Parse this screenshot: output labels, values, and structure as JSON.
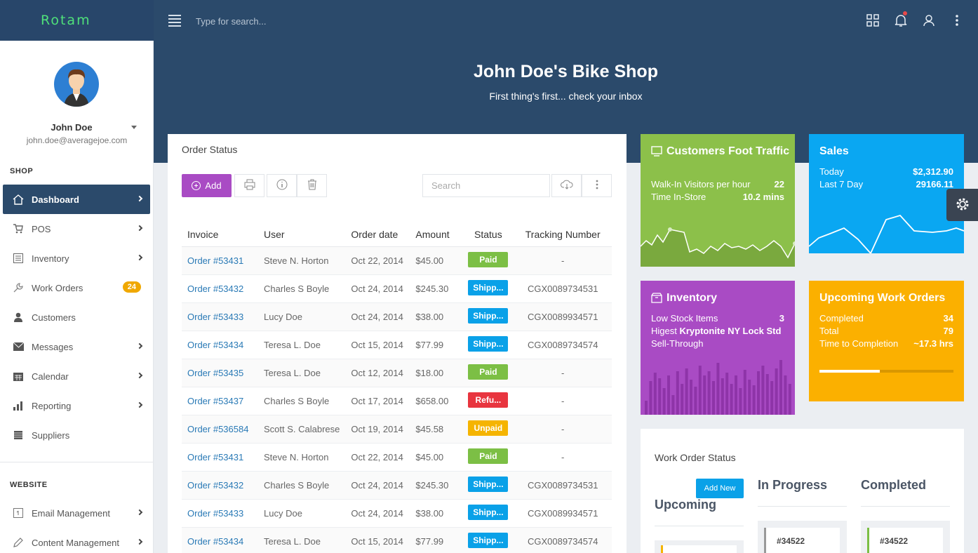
{
  "brand": "Rotam",
  "topbar": {
    "search_placeholder": "Type for search...",
    "icons": [
      "menu-icon",
      "grid-icon",
      "bell-icon",
      "user-icon",
      "more-vertical-icon"
    ]
  },
  "hero": {
    "title": "John Doe's Bike Shop",
    "subtitle": "First thing's first... check your inbox"
  },
  "user": {
    "name": "John Doe",
    "email": "john.doe@averagejoe.com"
  },
  "sidebar": {
    "shop_label": "SHOP",
    "items": [
      {
        "label": "Dashboard",
        "icon": "home-icon"
      },
      {
        "label": "POS",
        "icon": "cart-icon"
      },
      {
        "label": "Inventory",
        "icon": "list-icon"
      },
      {
        "label": "Work Orders",
        "icon": "wrench-icon",
        "badge": "24"
      },
      {
        "label": "Customers",
        "icon": "person-icon"
      },
      {
        "label": "Messages",
        "icon": "envelope-icon"
      },
      {
        "label": "Calendar",
        "icon": "calendar-icon"
      },
      {
        "label": "Reporting",
        "icon": "bar-chart-icon"
      },
      {
        "label": "Suppliers",
        "icon": "truck-icon"
      }
    ],
    "website_label": "WEBSITE",
    "website_items": [
      {
        "label": "Email Management",
        "icon": "email-icon"
      },
      {
        "label": "Content Management",
        "icon": "pencil-icon"
      }
    ]
  },
  "order_status": {
    "title": "Order Status",
    "add_label": "Add",
    "search_placeholder": "Search",
    "columns": [
      "Invoice",
      "User",
      "Order date",
      "Amount",
      "Status",
      "Tracking Number"
    ],
    "rows": [
      {
        "invoice": "Order #53431",
        "user": "Steve N. Horton",
        "date": "Oct 22, 2014",
        "amount": "$45.00",
        "status": "Paid",
        "tracking": "-"
      },
      {
        "invoice": "Order #53432",
        "user": "Charles S Boyle",
        "date": "Oct 24, 2014",
        "amount": "$245.30",
        "status": "Shipp...",
        "tracking": "CGX0089734531"
      },
      {
        "invoice": "Order #53433",
        "user": "Lucy Doe",
        "date": "Oct 24, 2014",
        "amount": "$38.00",
        "status": "Shipp...",
        "tracking": "CGX0089934571"
      },
      {
        "invoice": "Order #53434",
        "user": "Teresa L. Doe",
        "date": "Oct 15, 2014",
        "amount": "$77.99",
        "status": "Shipp...",
        "tracking": "CGX0089734574"
      },
      {
        "invoice": "Order #53435",
        "user": "Teresa L. Doe",
        "date": "Oct 12, 2014",
        "amount": "$18.00",
        "status": "Paid",
        "tracking": "-"
      },
      {
        "invoice": "Order #53437",
        "user": "Charles S Boyle",
        "date": "Oct 17, 2014",
        "amount": "$658.00",
        "status": "Refu...",
        "tracking": "-"
      },
      {
        "invoice": "Order #536584",
        "user": "Scott S. Calabrese",
        "date": "Oct 19, 2014",
        "amount": "$45.58",
        "status": "Unpaid",
        "tracking": "-"
      },
      {
        "invoice": "Order #53431",
        "user": "Steve N. Horton",
        "date": "Oct 22, 2014",
        "amount": "$45.00",
        "status": "Paid",
        "tracking": "-"
      },
      {
        "invoice": "Order #53432",
        "user": "Charles S Boyle",
        "date": "Oct 24, 2014",
        "amount": "$245.30",
        "status": "Shipp...",
        "tracking": "CGX0089734531"
      },
      {
        "invoice": "Order #53433",
        "user": "Lucy Doe",
        "date": "Oct 24, 2014",
        "amount": "$38.00",
        "status": "Shipp...",
        "tracking": "CGX0089934571"
      },
      {
        "invoice": "Order #53434",
        "user": "Teresa L. Doe",
        "date": "Oct 15, 2014",
        "amount": "$77.99",
        "status": "Shipp...",
        "tracking": "CGX0089734574"
      }
    ],
    "status_colors": {
      "Paid": "#7cbf45",
      "Shipp...": "#0aa1e8",
      "Refu...": "#e8353f",
      "Unpaid": "#f5b400"
    }
  },
  "widgets": {
    "traffic": {
      "title": "Customers Foot Traffic",
      "rows": [
        {
          "label": "Walk-In Visitors per hour",
          "value": "22"
        },
        {
          "label": "Time In-Store",
          "value": "10.2 mins"
        }
      ],
      "color": "#8cc04a"
    },
    "sales": {
      "title": "Sales",
      "rows": [
        {
          "label": "Today",
          "value": "$2,312.90"
        },
        {
          "label": "Last 7 Day",
          "value": "29166.11"
        }
      ],
      "color": "#0aa7f2"
    },
    "inventory": {
      "title": "Inventory",
      "low_stock_label": "Low Stock Items",
      "low_stock_value": "3",
      "highest_label": "Higest",
      "highest_value": "Kryptonite NY Lock Std",
      "sell_through_label": "Sell-Through",
      "color": "#a94bc4"
    },
    "work_orders": {
      "title": "Upcoming Work Orders",
      "rows": [
        {
          "label": "Completed",
          "value": "34"
        },
        {
          "label": "Total",
          "value": "79"
        },
        {
          "label": "Time to Completion",
          "value": "~17.3 hrs"
        }
      ],
      "progress": 0.45,
      "color": "#fbb000"
    }
  },
  "work_order_status": {
    "title": "Work Order Status",
    "add_new_label": "Add New",
    "columns": [
      "Upcoming",
      "In Progress",
      "Completed"
    ],
    "cards": [
      "#34522",
      "#34522"
    ]
  }
}
